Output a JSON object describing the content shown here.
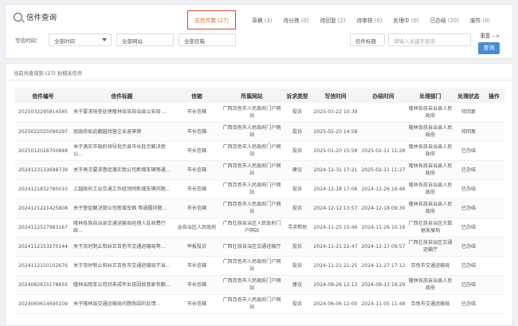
{
  "header": {
    "title": "信件查询"
  },
  "tabs": [
    {
      "label": "总信件数",
      "count": "(27)",
      "active": true
    },
    {
      "label": "草稿",
      "count": "(3)"
    },
    {
      "label": "待分拣",
      "count": "(0)"
    },
    {
      "label": "待回复",
      "count": "(2)"
    },
    {
      "label": "待审核",
      "count": "(0)"
    },
    {
      "label": "处理中",
      "count": "(0)"
    },
    {
      "label": "已办结",
      "count": "(20)"
    },
    {
      "label": "废件",
      "count": "(0)"
    }
  ],
  "filters": {
    "time_label": "写信时间：",
    "time_value": "全部时间",
    "site_value": "全部网站",
    "mailbox_value": "全部信箱",
    "title_label": "信件标题",
    "keyword_placeholder": "请输入关键字查询",
    "reset_label": "重置 -->",
    "query_label": "查询"
  },
  "list_header": {
    "prefix": "当前共查询到",
    "count": "(27)",
    "suffix": "封相关信件"
  },
  "table": {
    "columns": [
      "信件编号",
      "信件标题",
      "信箱",
      "所属网站",
      "诉求类型",
      "写信时间",
      "办结时间",
      "处理部门",
      "处理状态",
      "操作"
    ],
    "rows": [
      [
        "2025032295814585",
        "关于要求核查处理隆林各族自治县公安局 ...",
        "市长信箱",
        "广西百色市人民政府门户网站",
        "投诉",
        "2025-03-22 10:39",
        "",
        "隆林各族自治县人民政府",
        "待回复",
        ""
      ],
      [
        "2025022025090297",
        "屈政府如此翻越找营企业退来继",
        "市长信箱",
        "广西百色市人民政府门户网站",
        "投诉",
        "2025-02-20 14:58",
        "",
        "隆林各族自治县人民政府",
        "待回复",
        ""
      ],
      [
        "2025012028700848",
        "关于落实市政府领导批示县市长批示解决我公...",
        "市长信箱",
        "广西百色市人民政府门户网站",
        "投诉",
        "2025-01-20 15:58",
        "2025-02-11 11:28",
        "隆林各族自治县人民政府",
        "已办结",
        ""
      ],
      [
        "2024123133698739",
        "关于再次要求督促落实我公司新增车辆等通...",
        "市长信箱",
        "广西百色市人民政府门户网站",
        "建议",
        "2024-12-31 17:21",
        "2025-02-11 11:27",
        "隆林各族自治县人民政府",
        "已办结",
        ""
      ],
      [
        "2024121832780010",
        "上越政府工业交通工作组领同新增车辆问题...",
        "市长信箱",
        "广西百色市人民政府门户网站",
        "投诉",
        "2024-12-18 17:06",
        "2024-12-26 16:46",
        "隆林各族自治县人民政府",
        "已办结",
        ""
      ],
      [
        "2024121221425808",
        "关于督促解决我公司新增车辆 等通履问题...",
        "市长信箱",
        "广西百色市人民政府门户网站",
        "投诉",
        "2024-12-12 13:57",
        "2024-12-18 09:30",
        "隆林各族自治县人民政府",
        "已办结",
        ""
      ],
      [
        "2024112527983167",
        "隆林各族自治县交通运输局经理人乱收费行政...",
        "@自治区人民政府",
        "广西壮族自治区人民政府门户网站",
        "寻求帮助",
        "2024-11-25 15:46",
        "2024-11-26 10:16",
        "广西壮族自治区大数据发展局",
        "已办结",
        ""
      ],
      [
        "2024112153270144",
        "关于及时制止和纠正百色市交通运输局等...",
        "举报投诉",
        "广西壮族自治区交通运输厅",
        "投诉",
        "2024-11-21 22:47",
        "2024-12-17 09:57",
        "广西壮族自治区交通运输厅",
        "已办结",
        ""
      ],
      [
        "2024112150102676",
        "关于及时制止和纠正百色市交通运输局不当...",
        "市长信箱",
        "广西百色市人民政府门户网站",
        "投诉",
        "2024-11-21 21:25",
        "2024-12-27 17:12",
        "百色市交通运输局",
        "已办结",
        ""
      ],
      [
        "2024082615178655",
        "隆林出租车公司对未成年女孩因抵我家有额...",
        "市长信箱",
        "广西百色市人民政府门户网站",
        "建议",
        "2024-08-26 12:12",
        "2024-09-13 16:29",
        "隆林各族自治县人民政府",
        "已办结",
        ""
      ],
      [
        "2024060614690109",
        "关于隆林县交通运输局问题购因的反馈...",
        "市长信箱",
        "广西百色市人民政府门户网站",
        "投诉",
        "2024-06-06 12:00",
        "2024-11-05 11:48",
        "百色市交通运输局",
        "已办结",
        ""
      ]
    ]
  }
}
